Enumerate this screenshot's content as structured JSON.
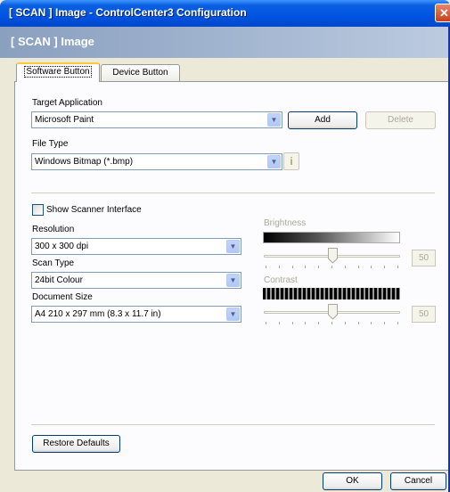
{
  "window": {
    "title": "[ SCAN ]  Image - ControlCenter3 Configuration",
    "close_glyph": "✕"
  },
  "header": {
    "text": "[ SCAN ]  Image"
  },
  "tabs": [
    {
      "label": "Software Button",
      "active": true
    },
    {
      "label": "Device Button",
      "active": false
    }
  ],
  "target_application": {
    "label": "Target Application",
    "value": "Microsoft Paint"
  },
  "buttons": {
    "add": "Add",
    "delete": "Delete",
    "restore": "Restore Defaults",
    "ok": "OK",
    "cancel": "Cancel"
  },
  "file_type": {
    "label": "File Type",
    "value": "Windows Bitmap (*.bmp)",
    "info_glyph": "i"
  },
  "show_scanner_interface": {
    "label": "Show Scanner Interface",
    "checked": false
  },
  "resolution": {
    "label": "Resolution",
    "value": "300 x 300 dpi"
  },
  "scan_type": {
    "label": "Scan Type",
    "value": "24bit Colour"
  },
  "document_size": {
    "label": "Document Size",
    "value": "A4 210 x 297 mm (8.3 x 11.7 in)"
  },
  "brightness": {
    "label": "Brightness",
    "value": "50"
  },
  "contrast": {
    "label": "Contrast",
    "value": "50"
  },
  "icons": {
    "dropdown_arrow": "▼"
  }
}
